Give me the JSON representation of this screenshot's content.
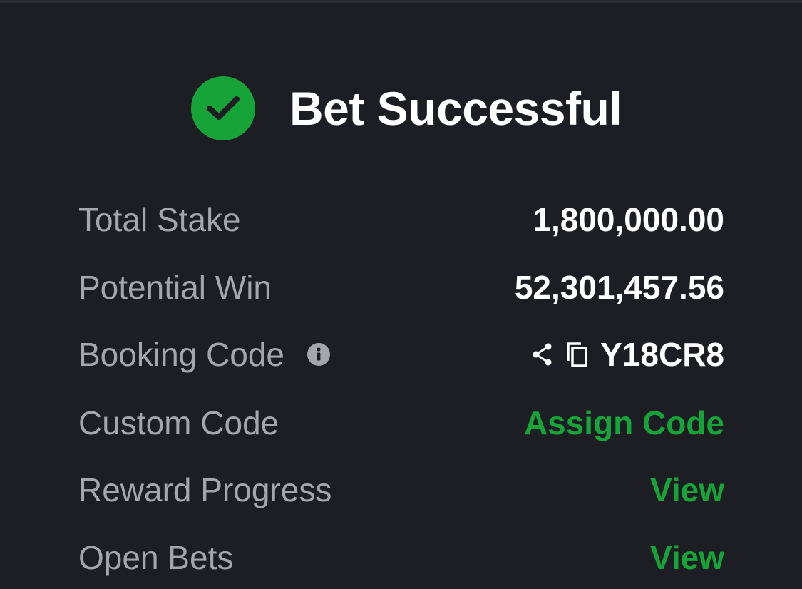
{
  "header": {
    "title": "Bet Successful",
    "status_icon": "check-circle-icon",
    "accent_color": "#16a338"
  },
  "rows": {
    "total_stake": {
      "label": "Total Stake",
      "value": "1,800,000.00"
    },
    "potential_win": {
      "label": "Potential Win",
      "value": "52,301,457.56"
    },
    "booking_code": {
      "label": "Booking Code",
      "info_icon": "info-icon",
      "share_icon": "share-icon",
      "copy_icon": "copy-icon",
      "value": "Y18CR8"
    },
    "custom_code": {
      "label": "Custom Code",
      "action": "Assign Code"
    },
    "reward_progress": {
      "label": "Reward Progress",
      "action": "View"
    },
    "open_bets": {
      "label": "Open Bets",
      "action": "View"
    }
  }
}
